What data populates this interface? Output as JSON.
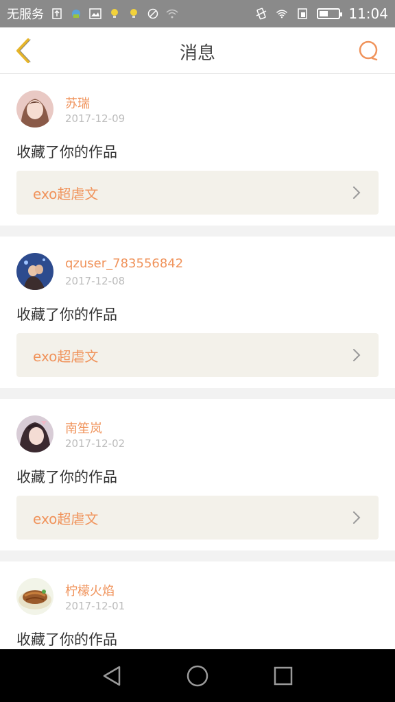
{
  "status_bar": {
    "carrier": "无服务",
    "time": "11:04",
    "battery_level": 0.45
  },
  "header": {
    "title": "消息",
    "back_icon": "chevron-left-icon",
    "search_icon": "search-icon"
  },
  "messages": [
    {
      "username": "苏瑞",
      "date": "2017-12-09",
      "text": "收藏了你的作品",
      "work_title": "exo超虐文",
      "avatar_color": "#e9c9c4"
    },
    {
      "username": "qzuser_783556842",
      "date": "2017-12-08",
      "text": "收藏了你的作品",
      "work_title": "exo超虐文",
      "avatar_color": "#2d4b8e"
    },
    {
      "username": "南笙岚",
      "date": "2017-12-02",
      "text": "收藏了你的作品",
      "work_title": "exo超虐文",
      "avatar_color": "#b8a7b8"
    },
    {
      "username": "柠檬火焰",
      "date": "2017-12-01",
      "text": "收藏了你的作品",
      "work_title": "",
      "avatar_color": "#9a5a2b"
    }
  ],
  "colors": {
    "accent": "#f0935b",
    "back_arrow": "#e6b52a",
    "card_bg": "#f3f1ea"
  }
}
